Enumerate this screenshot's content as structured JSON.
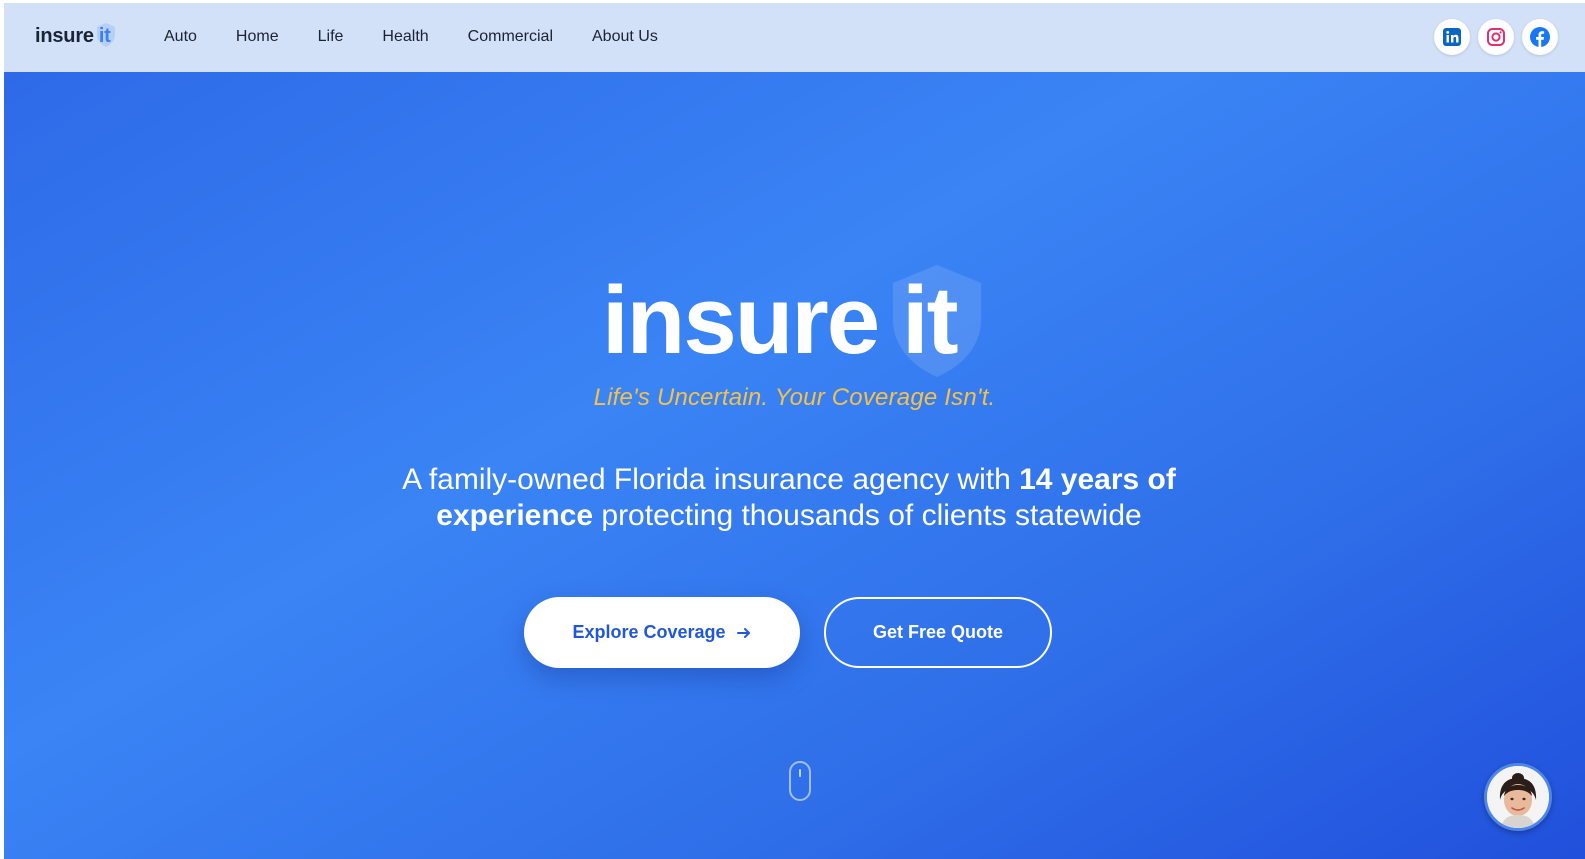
{
  "brand": {
    "name": "insure",
    "accent": "it"
  },
  "nav": {
    "links": [
      "Auto",
      "Home",
      "Life",
      "Health",
      "Commercial",
      "About Us"
    ]
  },
  "socials": [
    {
      "icon": "linkedin-icon",
      "color": "#0a66c2"
    },
    {
      "icon": "instagram-icon",
      "color": "#e1306c"
    },
    {
      "icon": "facebook-icon",
      "color": "#1877f2"
    }
  ],
  "hero": {
    "logo_word": "insure",
    "logo_accent": "it",
    "tagline": "Life's Uncertain. Your Coverage Isn't.",
    "subtitle_pre": "A family-owned Florida insurance agency with ",
    "subtitle_bold": "14 years of experience",
    "subtitle_post": " protecting thousands of clients statewide",
    "primary_button": "Explore Coverage",
    "secondary_button": "Get Free Quote"
  },
  "colors": {
    "nav_bg": "#d2e1f8",
    "hero_blue": "#3a84f5",
    "tagline_gold": "#f4c14b",
    "button_text_blue": "#2157d8"
  }
}
